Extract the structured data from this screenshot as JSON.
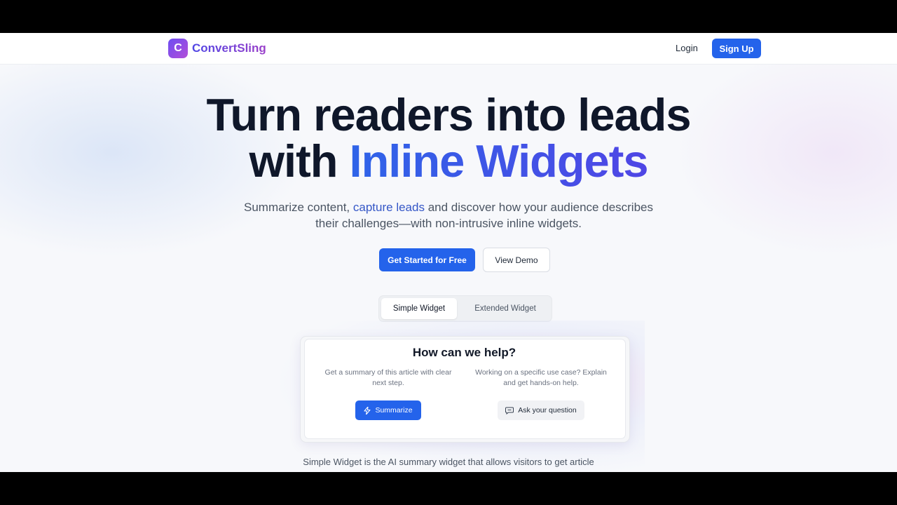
{
  "header": {
    "logo_letter": "C",
    "brand_name": "ConvertSling",
    "login_label": "Login",
    "signup_label": "Sign Up"
  },
  "hero": {
    "title_line1": "Turn readers into leads",
    "title_line2_prefix": "with ",
    "title_line2_accent": "Inline Widgets",
    "subtitle_part1": "Summarize content, ",
    "subtitle_highlight": "capture leads",
    "subtitle_part2": " and discover how your audience describes their challenges—with non-intrusive inline widgets.",
    "primary_cta": "Get Started for Free",
    "secondary_cta": "View Demo"
  },
  "tabs": [
    {
      "label": "Simple Widget",
      "active": true
    },
    {
      "label": "Extended Widget",
      "active": false
    }
  ],
  "widget": {
    "title": "How can we help?",
    "left_text": "Get a summary of this article with clear next step.",
    "right_text": "Working on a specific use case? Explain and get hands-on help.",
    "summarize_label": "Summarize",
    "summarize_icon": "lightning-icon",
    "ask_label": "Ask your question",
    "ask_icon": "chat-bubble-icon"
  },
  "caption": "Simple Widget is the AI summary widget that allows visitors to get article",
  "colors": {
    "primary": "#2463eb",
    "brand_gradient_start": "#6d4df2",
    "brand_gradient_end": "#b34fd8",
    "heading": "#0f172a"
  }
}
